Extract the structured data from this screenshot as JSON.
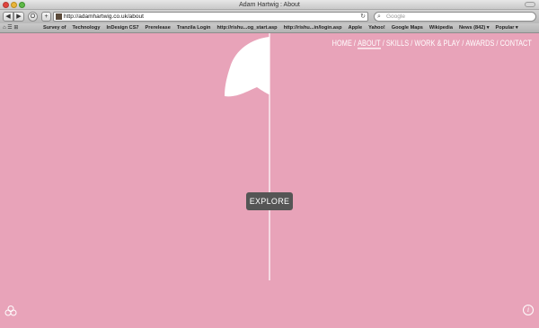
{
  "window": {
    "title": "Adam Hartwig : About"
  },
  "toolbar": {
    "back_icon": "◀",
    "forward_icon": "▶",
    "url": "http://adamhartwig.co.uk/about",
    "reload_icon": "↻",
    "search_placeholder": "Google",
    "search_icon": "⌕",
    "add_icon": "+"
  },
  "bookmarks": {
    "tools": "⌂ ☰ ⊞",
    "items": [
      "Survey of",
      "Technology",
      "InDesign CS7",
      "Prerelease",
      "Tranzila Login",
      "http://rishu...og_start.asp",
      "http://rishu...in/login.asp",
      "Apple",
      "Yahoo!",
      "Google Maps",
      "Wikipedia",
      "News (842) ▾",
      "Popular ▾"
    ]
  },
  "site_nav": {
    "items": [
      "HOME",
      "ABOUT",
      "SKILLS",
      "WORK & PLAY",
      "AWARDS",
      "CONTACT"
    ],
    "separator": "/",
    "active": "ABOUT"
  },
  "hero": {
    "button_label": "EXPLORE"
  },
  "footer": {
    "info_glyph": "i"
  },
  "colors": {
    "background": "#e8a3b9",
    "figure": "#ffffff",
    "button": "#555555"
  }
}
